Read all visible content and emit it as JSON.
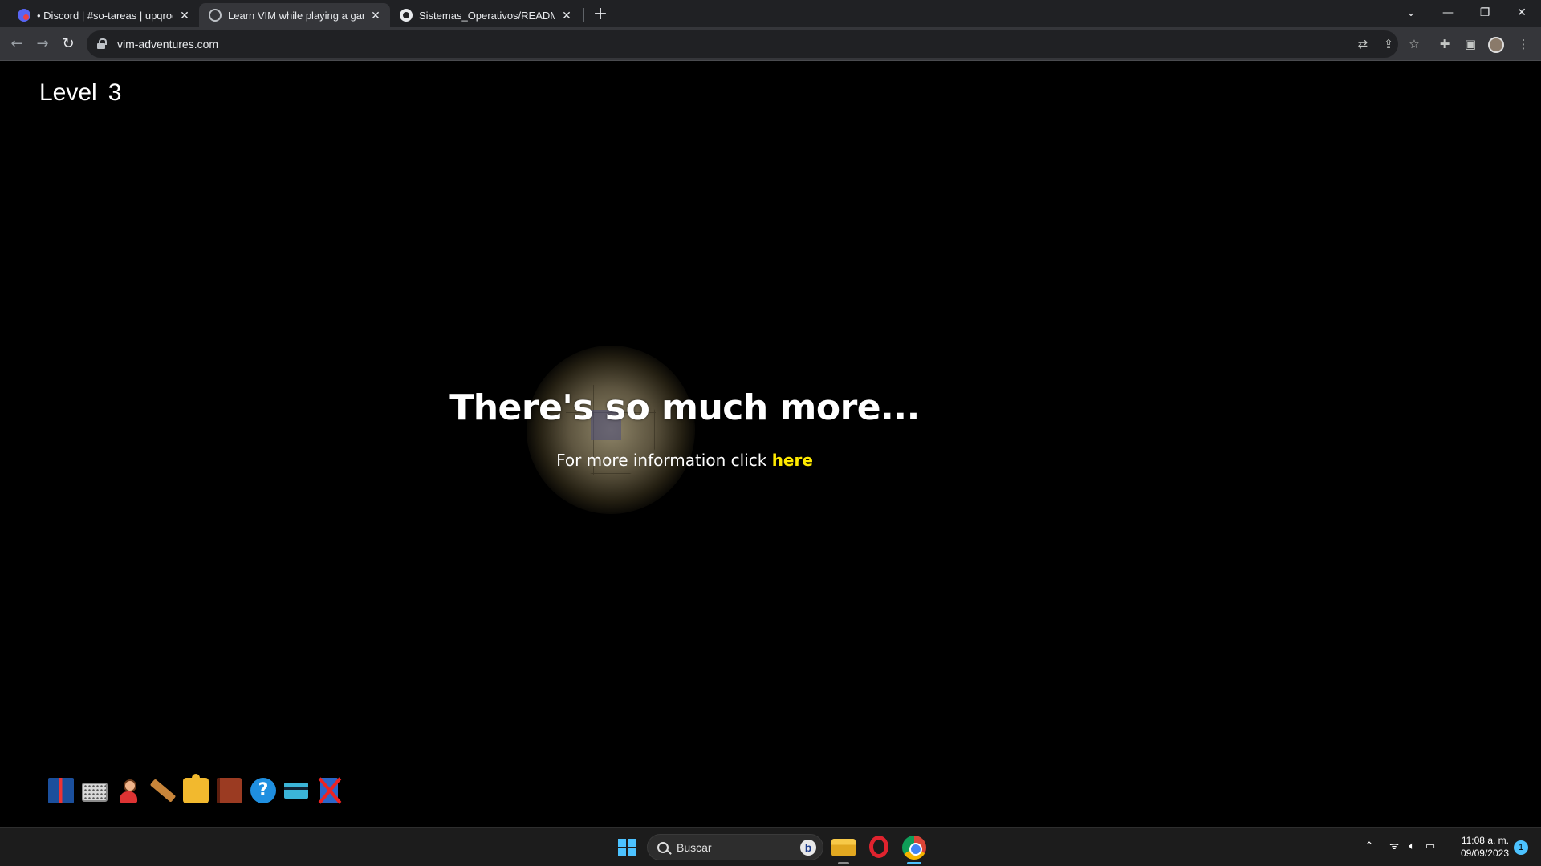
{
  "browser": {
    "tabs": [
      {
        "title": "• Discord | #so-tareas | upqroo",
        "favicon": "discord-icon",
        "active": false
      },
      {
        "title": "Learn VIM while playing a game",
        "favicon": "globe-icon",
        "active": true
      },
      {
        "title": "Sistemas_Operativos/README.m",
        "favicon": "github-icon",
        "active": false
      }
    ],
    "new_tab_label": "+",
    "url": "vim-adventures.com"
  },
  "game": {
    "level_label": "Level",
    "level_number": "3",
    "headline": "There's so much more...",
    "subline_text": "For more information click",
    "subline_link": "here",
    "link_color": "#ffea00",
    "items": [
      "book-icon",
      "keyboard-icon",
      "character-icon",
      "ruler-icon",
      "puzzle-icon",
      "tome-icon",
      "help-icon",
      "card-icon",
      "crossed-out-icon"
    ]
  },
  "taskbar": {
    "search_placeholder": "Buscar",
    "time": "11:08 a. m.",
    "date": "09/09/2023",
    "notification_count": "1",
    "accent": "#4cc2ff"
  }
}
